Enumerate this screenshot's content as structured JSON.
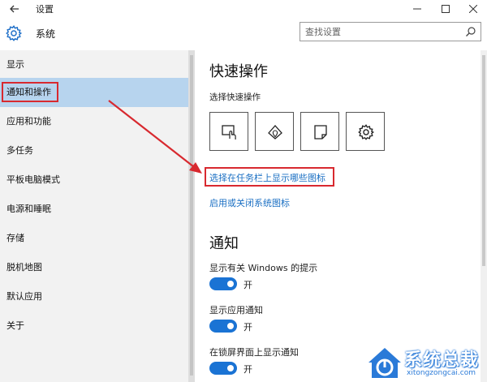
{
  "window": {
    "title": "设置",
    "back_icon": "arrow-left-icon",
    "minimize_icon": "minimize-icon",
    "maximize_icon": "maximize-icon",
    "close_icon": "close-icon"
  },
  "header": {
    "icon": "gear-icon",
    "title": "系统",
    "search_placeholder": "查找设置",
    "search_icon": "search-icon"
  },
  "sidebar": {
    "items": [
      {
        "label": "显示",
        "selected": false
      },
      {
        "label": "通知和操作",
        "selected": true
      },
      {
        "label": "应用和功能",
        "selected": false
      },
      {
        "label": "多任务",
        "selected": false
      },
      {
        "label": "平板电脑模式",
        "selected": false
      },
      {
        "label": "电源和睡眠",
        "selected": false
      },
      {
        "label": "存储",
        "selected": false
      },
      {
        "label": "脱机地图",
        "selected": false
      },
      {
        "label": "默认应用",
        "selected": false
      },
      {
        "label": "关于",
        "selected": false
      }
    ]
  },
  "main": {
    "quick_actions": {
      "heading": "快速操作",
      "subheading": "选择快速操作",
      "buttons": [
        {
          "icon": "tablet-mode-icon"
        },
        {
          "icon": "location-icon"
        },
        {
          "icon": "note-icon"
        },
        {
          "icon": "settings-gear-icon"
        }
      ]
    },
    "links": {
      "taskbar_icons": "选择在任务栏上显示哪些图标",
      "system_icons": "启用或关闭系统图标"
    },
    "notifications": {
      "heading": "通知",
      "settings": [
        {
          "label": "显示有关 Windows 的提示",
          "state": "开",
          "on": true
        },
        {
          "label": "显示应用通知",
          "state": "开",
          "on": true
        },
        {
          "label": "在锁屏界面上显示通知",
          "state": "开",
          "on": true
        }
      ]
    }
  },
  "annotations": {
    "highlight_color": "#d8292f",
    "accent_color": "#1a73d4"
  },
  "watermark": {
    "title": "系统总裁",
    "url": "xitongzongcai.com"
  }
}
